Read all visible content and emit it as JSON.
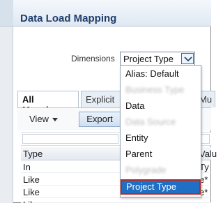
{
  "header": {
    "title": "Data Load Mapping"
  },
  "dimensions": {
    "label": "Dimensions",
    "selected": "Project Type"
  },
  "tabs": [
    {
      "label": "All Mappings"
    },
    {
      "label": "Explicit"
    },
    {
      "label": "Mu"
    }
  ],
  "toolbar": {
    "view_label": "View",
    "export_label": "Export"
  },
  "table": {
    "columns": [
      "Type",
      "Valu"
    ],
    "rows": [
      {
        "type": "In",
        "value": "Ty"
      },
      {
        "type": "Like",
        "value": "e*"
      },
      {
        "type": "Like",
        "value": "e*"
      },
      {
        "type": "Like",
        "value": ""
      }
    ]
  },
  "dropdown": {
    "options": [
      {
        "label": "Alias: Default",
        "obscured": false,
        "selected": false
      },
      {
        "label": "Business Type",
        "obscured": true,
        "selected": false
      },
      {
        "label": "Data",
        "obscured": false,
        "selected": false
      },
      {
        "label": "Data Source",
        "obscured": true,
        "selected": false
      },
      {
        "label": "Entity",
        "obscured": false,
        "selected": false
      },
      {
        "label": "Parent",
        "obscured": false,
        "selected": false
      },
      {
        "label": "Polygrade",
        "obscured": true,
        "selected": false
      },
      {
        "label": "Project Type",
        "obscured": false,
        "selected": true
      }
    ]
  },
  "colors": {
    "accent": "#1f6fc5",
    "selection_border": "#c2261d",
    "title": "#1f3d6b"
  }
}
